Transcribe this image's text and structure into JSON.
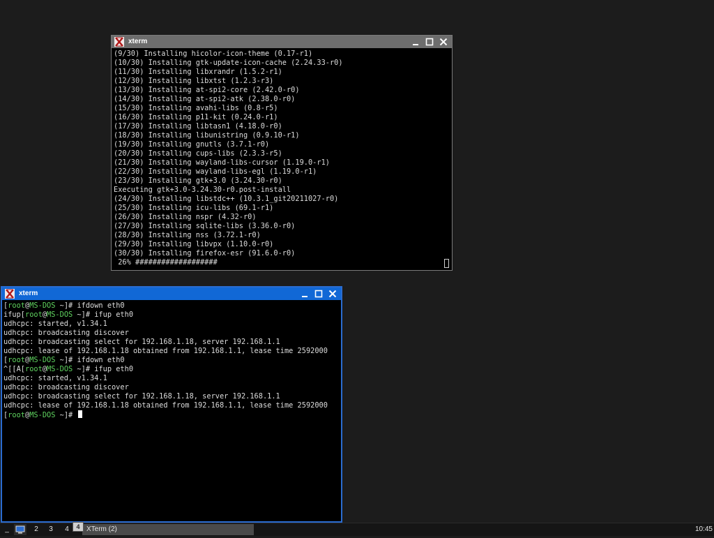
{
  "colors": {
    "desktop": "#1c1c1c",
    "active_titlebar": "#1168d6",
    "inactive_titlebar": "#6d6d6d",
    "prompt_green": "#5fd35f",
    "terminal_text": "#dcdcdc"
  },
  "window1": {
    "title": "xterm",
    "icons": {
      "minimize": "minimize-icon",
      "maximize": "maximize-icon",
      "close": "close-icon"
    },
    "lines": [
      "(9/30) Installing hicolor-icon-theme (0.17-r1)",
      "(10/30) Installing gtk-update-icon-cache (2.24.33-r0)",
      "(11/30) Installing libxrandr (1.5.2-r1)",
      "(12/30) Installing libxtst (1.2.3-r3)",
      "(13/30) Installing at-spi2-core (2.42.0-r0)",
      "(14/30) Installing at-spi2-atk (2.38.0-r0)",
      "(15/30) Installing avahi-libs (0.8-r5)",
      "(16/30) Installing p11-kit (0.24.0-r1)",
      "(17/30) Installing libtasn1 (4.18.0-r0)",
      "(18/30) Installing libunistring (0.9.10-r1)",
      "(19/30) Installing gnutls (3.7.1-r0)",
      "(20/30) Installing cups-libs (2.3.3-r5)",
      "(21/30) Installing wayland-libs-cursor (1.19.0-r1)",
      "(22/30) Installing wayland-libs-egl (1.19.0-r1)",
      "(23/30) Installing gtk+3.0 (3.24.30-r0)",
      "Executing gtk+3.0-3.24.30-r0.post-install",
      "(24/30) Installing libstdc++ (10.3.1_git20211027-r0)",
      "(25/30) Installing icu-libs (69.1-r1)",
      "(26/30) Installing nspr (4.32-r0)",
      "(27/30) Installing sqlite-libs (3.36.0-r0)",
      "(28/30) Installing nss (3.72.1-r0)",
      "(29/30) Installing libvpx (1.10.0-r0)",
      "(30/30) Installing firefox-esr (91.6.0-r0)",
      " 26% ###################"
    ]
  },
  "window2": {
    "title": "xterm",
    "prompt_user": "root",
    "prompt_at": "@",
    "prompt_host": "MS-DOS",
    "prompt_path": " ~",
    "prompt_end": "]# ",
    "lines": [
      {
        "pre": "[",
        "cmd": "ifdown eth0",
        "prompt": true
      },
      {
        "pre": "ifup[",
        "cmd": "ifup eth0",
        "prompt": true
      },
      {
        "text": "udhcpc: started, v1.34.1"
      },
      {
        "text": "udhcpc: broadcasting discover"
      },
      {
        "text": "udhcpc: broadcasting select for 192.168.1.18, server 192.168.1.1"
      },
      {
        "text": "udhcpc: lease of 192.168.1.18 obtained from 192.168.1.1, lease time 2592000"
      },
      {
        "pre": "[",
        "cmd": "ifdown eth0",
        "prompt": true
      },
      {
        "pre": "^[[A[",
        "cmd": "ifup eth0",
        "prompt": true
      },
      {
        "text": "udhcpc: started, v1.34.1"
      },
      {
        "text": "udhcpc: broadcasting discover"
      },
      {
        "text": "udhcpc: broadcasting select for 192.168.1.18, server 192.168.1.1"
      },
      {
        "text": "udhcpc: lease of 192.168.1.18 obtained from 192.168.1.1, lease time 2592000"
      },
      {
        "pre": "[",
        "cmd": "",
        "prompt": true,
        "cursor": true
      }
    ]
  },
  "taskbar": {
    "menu_label": "_",
    "workspaces": [
      "2",
      "3",
      "4"
    ],
    "task_label": "XTerm (2)",
    "tooltip": "4",
    "clock": "10:45"
  }
}
